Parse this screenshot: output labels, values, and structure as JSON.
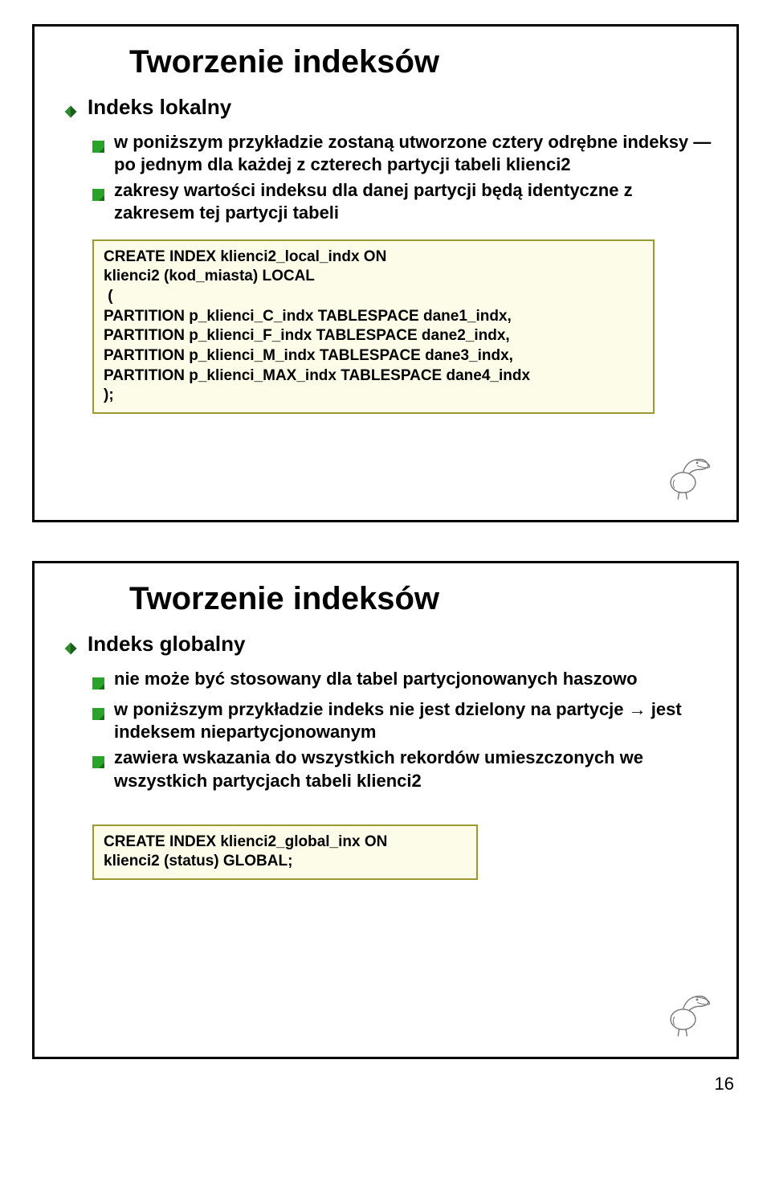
{
  "page_number": "16",
  "slide1": {
    "title": "Tworzenie indeksów",
    "h1": "Indeks lokalny",
    "b1": "w poniższym przykładzie zostaną utworzone cztery odrębne indeksy — po jednym dla każdej z czterech partycji tabeli klienci2",
    "b2": "zakresy wartości indeksu dla danej partycji będą identyczne z zakresem tej partycji tabeli",
    "code": "CREATE INDEX klienci2_local_indx ON\nklienci2 (kod_miasta) LOCAL\n (\nPARTITION p_klienci_C_indx TABLESPACE dane1_indx,\nPARTITION p_klienci_F_indx TABLESPACE dane2_indx,\nPARTITION p_klienci_M_indx TABLESPACE dane3_indx,\nPARTITION p_klienci_MAX_indx TABLESPACE dane4_indx\n);"
  },
  "slide2": {
    "title": "Tworzenie indeksów",
    "h1": "Indeks globalny",
    "b1": "nie może być stosowany dla tabel partycjonowanych haszowo",
    "b2": "w poniższym przykładzie indeks nie jest dzielony na partycje → jest indeksem niepartycjonowanym",
    "b3": "zawiera wskazania do wszystkich rekordów umieszczonych we wszystkich partycjach tabeli klienci2",
    "code": "CREATE INDEX klienci2_global_inx ON\nklienci2 (status) GLOBAL;"
  }
}
